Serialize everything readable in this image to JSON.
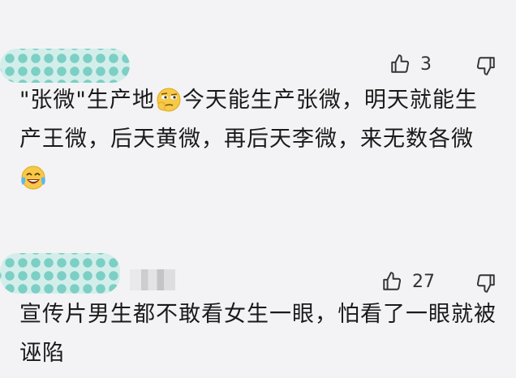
{
  "comments": [
    {
      "text_part1": "\"张微\"生产地",
      "emoji1": "thinking-face-emoji",
      "text_part2": "今天能生产张微，明天就能生产王微，后天黄微，再后天李微，来无数各微",
      "emoji2": "crying-laughing-emoji",
      "likes": "3"
    },
    {
      "text": "宣传片男生都不敢看女生一眼，怕看了一眼就被诬陷",
      "likes": "27"
    }
  ],
  "colors": {
    "mosaic_bg": "#d3eeea",
    "mosaic_dot": "#7ccfc4",
    "background": "#f3f3f5"
  },
  "icons": [
    "thumbs-up-icon",
    "thumbs-down-icon"
  ]
}
